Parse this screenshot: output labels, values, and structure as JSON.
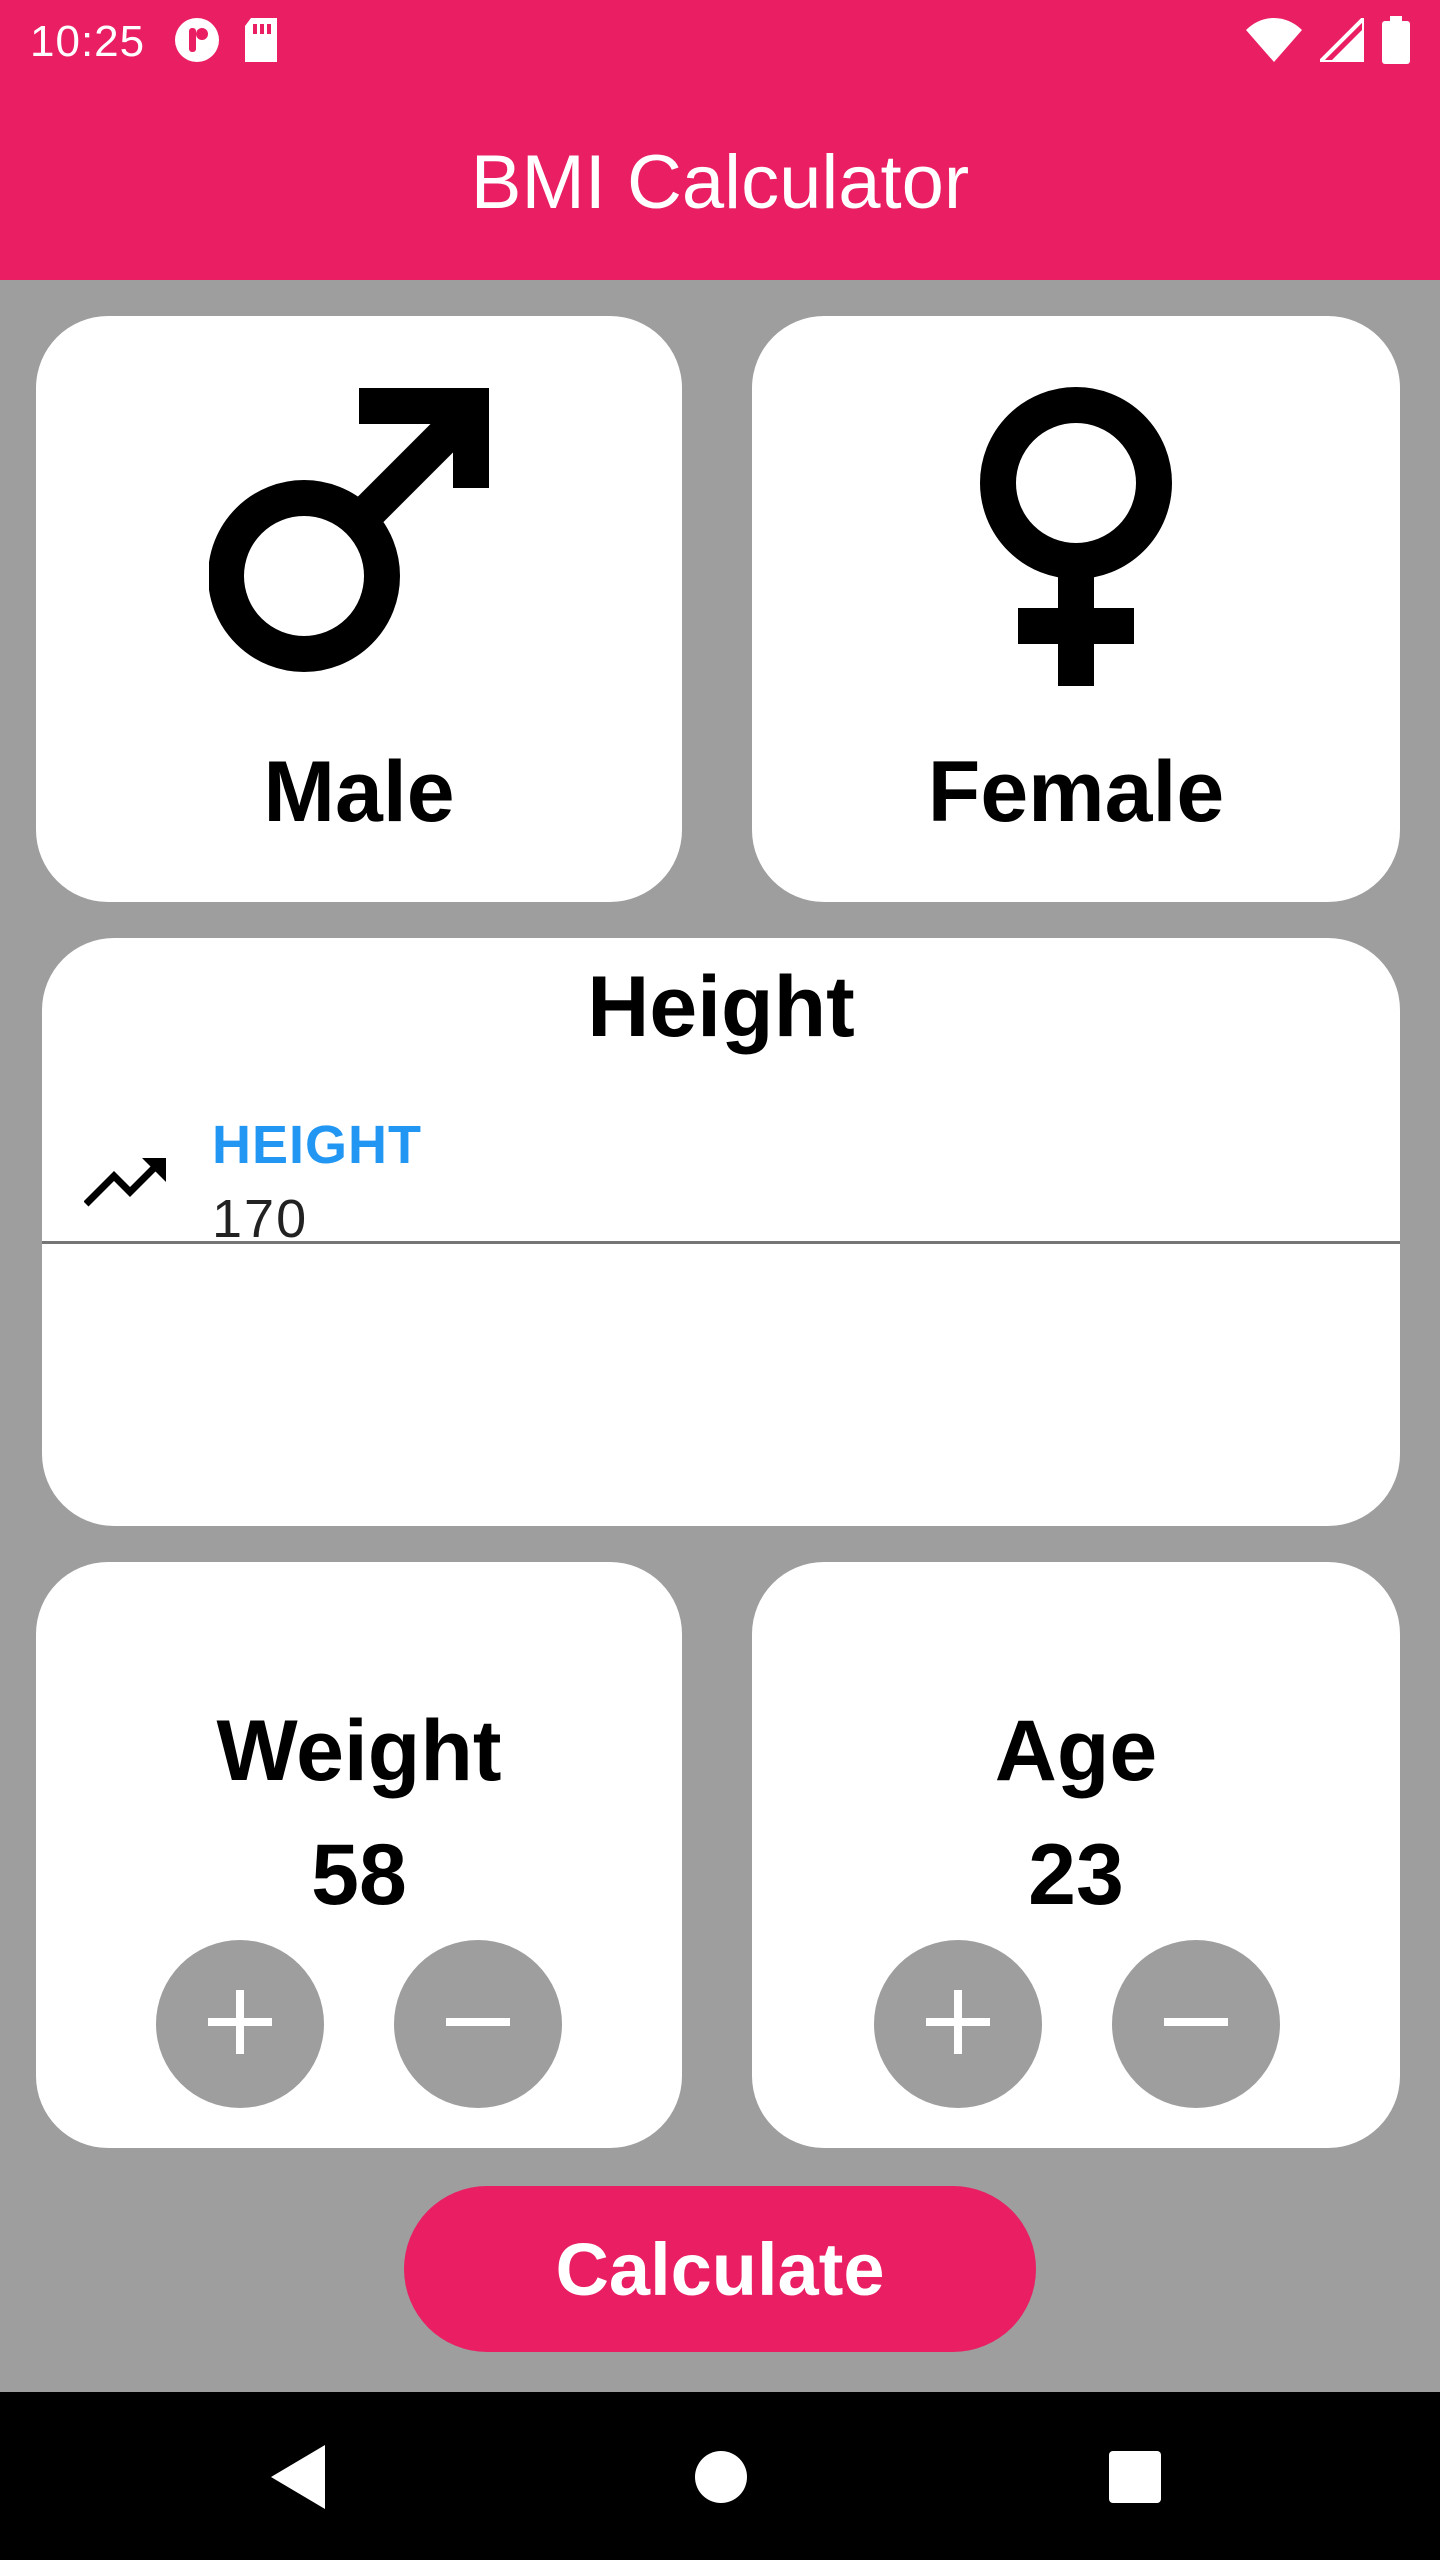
{
  "status_bar": {
    "time": "10:25",
    "left_icons": [
      "notification-app-icon",
      "sd-card-icon"
    ],
    "right_icons": [
      "wifi-icon",
      "cell-signal-icon",
      "battery-icon"
    ]
  },
  "app_bar": {
    "title": "BMI Calculator"
  },
  "gender": {
    "male": {
      "label": "Male",
      "icon": "male-symbol-icon"
    },
    "female": {
      "label": "Female",
      "icon": "female-symbol-icon"
    }
  },
  "height_card": {
    "title": "Height",
    "field_label": "HEIGHT",
    "field_value": "170",
    "icon": "trending-up-icon",
    "label_color": "#2196f3"
  },
  "weight_card": {
    "title": "Weight",
    "value": "58",
    "increment_icon": "plus-icon",
    "decrement_icon": "minus-icon"
  },
  "age_card": {
    "title": "Age",
    "value": "23",
    "increment_icon": "plus-icon",
    "decrement_icon": "minus-icon"
  },
  "calculate_button": {
    "label": "Calculate"
  },
  "nav_bar": {
    "icons": [
      "back-icon",
      "home-icon",
      "recents-icon"
    ]
  },
  "colors": {
    "accent": "#e91e63",
    "background": "#9e9e9e",
    "card": "#ffffff"
  }
}
